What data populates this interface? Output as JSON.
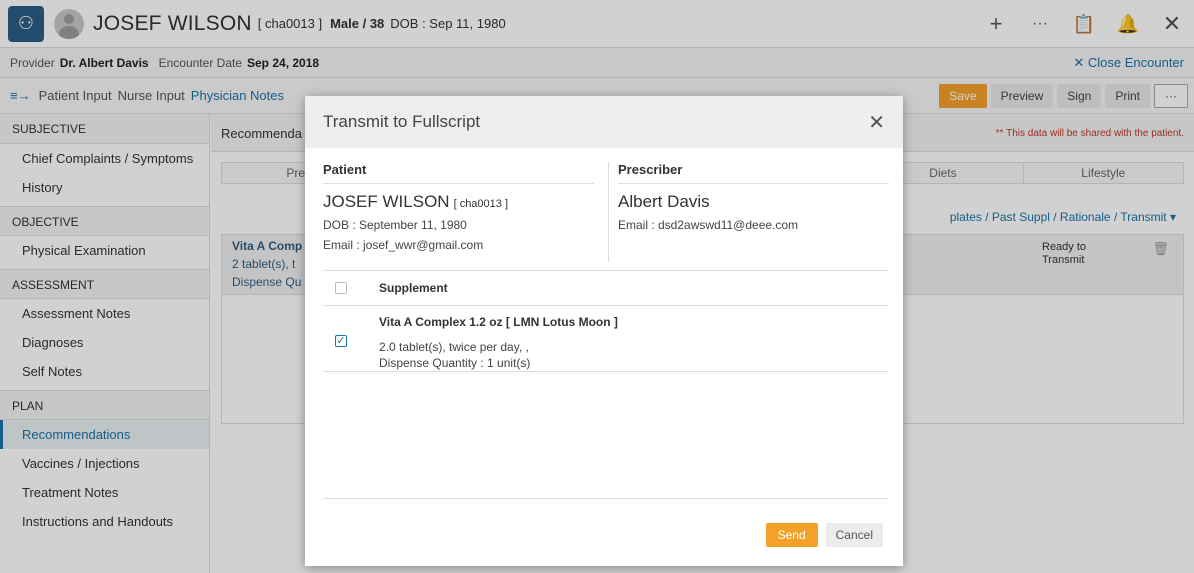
{
  "header": {
    "patient_name": "JOSEF WILSON",
    "patient_id": "[ cha0013 ]",
    "patient_meta": "Male / 38",
    "dob_label": "DOB : Sep 11, 1980",
    "icons": [
      "plus-icon",
      "more-icon",
      "clipboard-icon",
      "bell-icon",
      "close-icon"
    ]
  },
  "provider_bar": {
    "provider_label": "Provider",
    "provider_name": "Dr. Albert Davis",
    "encounter_label": "Encounter Date",
    "encounter_date": "Sep 24, 2018",
    "close_encounter": "Close Encounter"
  },
  "tabs": {
    "items": [
      "Patient Input",
      "Nurse Input",
      "Physician Notes"
    ],
    "active": "Physician Notes",
    "actions": {
      "save": "Save",
      "preview": "Preview",
      "sign": "Sign",
      "print": "Print",
      "more": "···"
    }
  },
  "sidebar": {
    "sections": [
      {
        "title": "SUBJECTIVE",
        "items": [
          "Chief Complaints / Symptoms",
          "History"
        ]
      },
      {
        "title": "OBJECTIVE",
        "items": [
          "Physical Examination"
        ]
      },
      {
        "title": "ASSESSMENT",
        "items": [
          "Assessment Notes",
          "Diagnoses",
          "Self Notes"
        ]
      },
      {
        "title": "PLAN",
        "items": [
          "Recommendations",
          "Vaccines / Injections",
          "Treatment Notes",
          "Instructions and Handouts"
        ]
      }
    ],
    "active_item": "Recommendations"
  },
  "main": {
    "title": "Recommenda",
    "shared_note": "** This data will be shared with the patient.",
    "sub_tabs": [
      "Presc",
      "",
      "",
      "",
      "Diets",
      "Lifestyle"
    ],
    "links": "plates  /  Past Suppl  /  Rationale  /  Transmit",
    "bg_item_name": "Vita A Comp",
    "bg_item_line2": "2 tablet(s), t",
    "bg_item_line3": "Dispense Qu",
    "status": "Ready to Transmit"
  },
  "modal": {
    "title": "Transmit to Fullscript",
    "patient_label": "Patient",
    "patient_name": "JOSEF WILSON",
    "patient_id": "[ cha0013 ]",
    "patient_dob": "DOB : September 11, 1980",
    "patient_email": "Email : josef_wwr@gmail.com",
    "prescriber_label": "Prescriber",
    "prescriber_name": "Albert Davis",
    "prescriber_email": "Email : dsd2awswd11@deee.com",
    "table_header": "Supplement",
    "supplement": {
      "name": "Vita A Complex 1.2 oz [ LMN Lotus Moon ]",
      "dosage": "2.0 tablet(s), twice per day, ,",
      "quantity": "Dispense Quantity : 1 unit(s)",
      "checked": true
    },
    "send_label": "Send",
    "cancel_label": "Cancel"
  }
}
